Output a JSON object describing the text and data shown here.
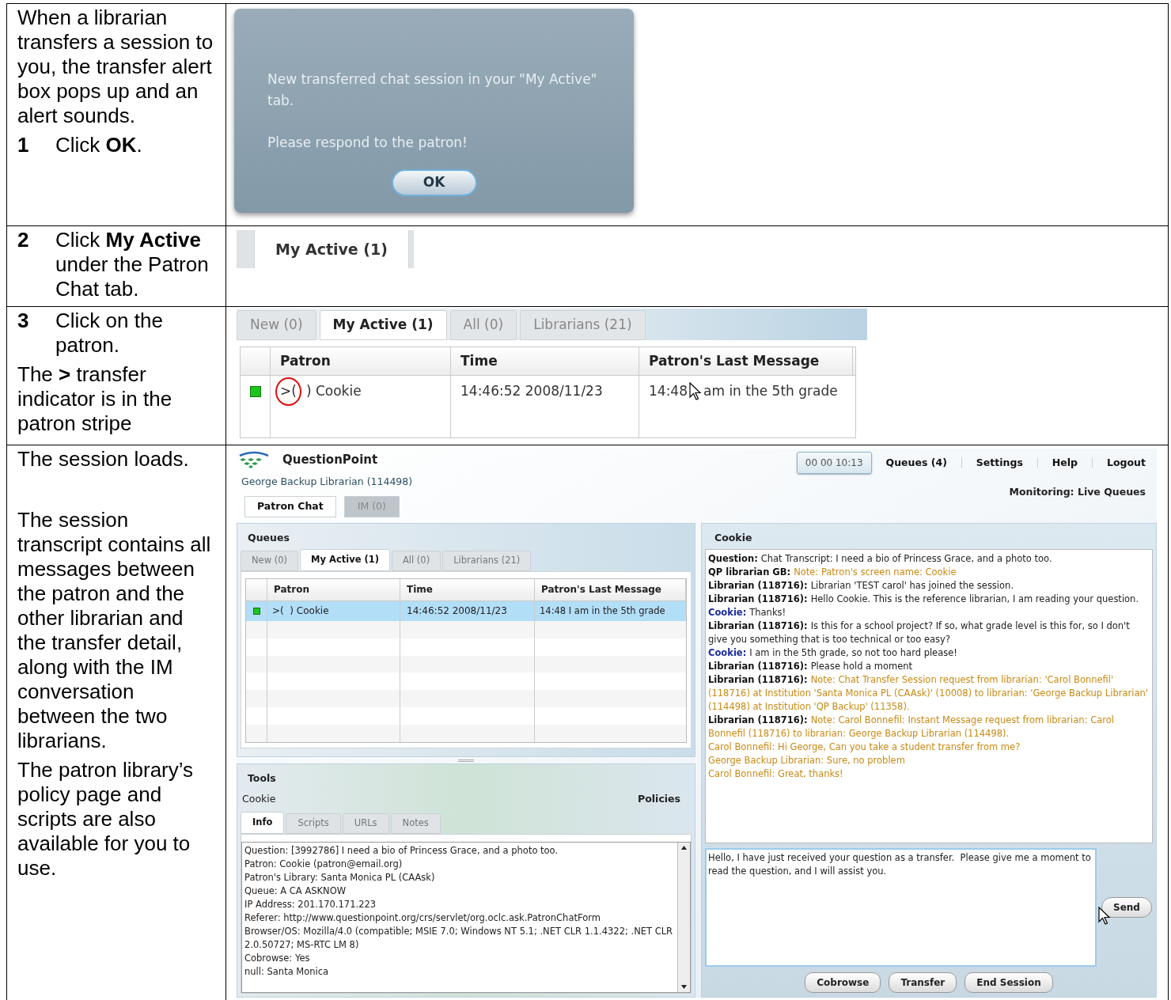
{
  "rows": [
    {
      "kind": "alert",
      "instructions": [
        {
          "text": "When a librarian transfers a session to you, the transfer alert box pops up and an alert sounds."
        },
        {
          "number": "1",
          "text": "Click **OK**."
        }
      ],
      "alert": {
        "message": "New transferred chat session in your \"My Active\" tab.",
        "prompt": "Please respond to the patron!",
        "button": "OK"
      }
    },
    {
      "kind": "tab",
      "instructions": [
        {
          "number": "2",
          "text": "Click **My Active** under the Patron Chat tab."
        }
      ],
      "tab": {
        "label": "My Active (1)",
        "selected": true
      }
    },
    {
      "kind": "queue",
      "instructions": [
        {
          "number": "3",
          "text": "Click on the patron."
        },
        {
          "text": "The **>** transfer indicator is in the patron stripe"
        }
      ],
      "queue": {
        "tabs": [
          {
            "label": "New (0)",
            "selected": false
          },
          {
            "label": "My Active (1)",
            "selected": true
          },
          {
            "label": "All (0)",
            "selected": false
          },
          {
            "label": "Librarians (21)",
            "selected": false
          }
        ],
        "columns": [
          "Patron",
          "Time",
          "Patron's Last Message"
        ],
        "row": {
          "indicator": ">(",
          "patron": ") Cookie",
          "time": "14:46:52 2008/11/23",
          "message_start": "14:48",
          "message_end": "am in the 5th grade"
        }
      }
    },
    {
      "kind": "session",
      "instructions": [
        {
          "text": "The session loads."
        },
        {
          "text": "The session transcript contains all messages between the patron and the other librarian and the transfer detail, along with the IM conversation between the two librarians."
        },
        {
          "text": "The patron library’s policy page and scripts are also available for you to use."
        }
      ],
      "app": {
        "brand": "QuestionPoint",
        "user": "George Backup Librarian (114498)",
        "timer": "00 00 10:13",
        "nav": [
          "Queues (4)",
          "Settings",
          "Help",
          "Logout"
        ],
        "monitoring": "Monitoring: Live Queues",
        "main_tabs": [
          {
            "label": "Patron Chat",
            "selected": true
          },
          {
            "label": "IM (0)",
            "selected": false
          }
        ],
        "queues": {
          "title": "Queues",
          "tabs": [
            {
              "label": "New (0)",
              "selected": false
            },
            {
              "label": "My Active (1)",
              "selected": true
            },
            {
              "label": "All (0)",
              "selected": false
            },
            {
              "label": "Librarians (21)",
              "selected": false
            }
          ],
          "columns": [
            "Patron",
            "Time",
            "Patron's Last Message"
          ],
          "rows": [
            {
              "patron": ">(  ) Cookie",
              "time": "14:46:52 2008/11/23",
              "message": "14:48 I am in the 5th grade",
              "selected": true
            }
          ]
        },
        "tools": {
          "title": "Tools",
          "patron": "Cookie",
          "policies": "Policies",
          "tabs": [
            {
              "label": "Info",
              "selected": true
            },
            {
              "label": "Scripts",
              "selected": false
            },
            {
              "label": "URLs",
              "selected": false
            },
            {
              "label": "Notes",
              "selected": false
            }
          ],
          "info": [
            "Question: [3992786] I need a bio of Princess Grace, and a photo too.",
            "Patron: Cookie (patron@email.org)",
            "Patron's Library: Santa Monica PL (CAAsk)",
            "Queue: A CA ASKNOW",
            "IP Address: 201.170.171.223",
            "Referer: http://www.questionpoint.org/crs/servlet/org.oclc.ask.PatronChatForm",
            "Browser/OS: Mozilla/4.0 (compatible; MSIE 7.0; Windows NT 5.1; .NET CLR 1.1.4322; .NET CLR 2.0.50727; MS-RTC LM 8)",
            "Cobrowse: Yes",
            "null: Santa Monica"
          ]
        },
        "chat": {
          "title": "Cookie",
          "transcript": [
            {
              "speaker": "Question:",
              "kind": "staff_message",
              "text": "Chat Transcript: I need a bio of Princess Grace, and a photo too."
            },
            {
              "speaker": "QP librarian GB:",
              "kind": "staff_note",
              "text": "Note: Patron's screen name: Cookie"
            },
            {
              "speaker": "Librarian (118716):",
              "kind": "staff_message",
              "text": "Librarian 'TEST carol' has joined the session."
            },
            {
              "speaker": "Librarian (118716):",
              "kind": "staff_message",
              "text": "Hello Cookie. This is the reference librarian, I am reading your question."
            },
            {
              "speaker": "Cookie:",
              "kind": "patron_message",
              "text": "Thanks!"
            },
            {
              "speaker": "Librarian (118716):",
              "kind": "staff_message",
              "text": "Is this for a school project? If so, what grade level is this for, so I don't give you something that is too technical or too easy?"
            },
            {
              "speaker": "Cookie:",
              "kind": "patron_message",
              "text": "I am in the 5th grade, so not too hard please!"
            },
            {
              "speaker": "Librarian (118716):",
              "kind": "staff_message",
              "text": "Please hold a moment"
            },
            {
              "speaker": "Librarian (118716):",
              "kind": "staff_note",
              "text": "Note: Chat Transfer Session request from librarian: 'Carol Bonnefil' (118716) at Institution 'Santa Monica PL (CAAsk)' (10008) to librarian: 'George Backup Librarian' (114498) at Institution 'QP Backup' (11358)."
            },
            {
              "speaker": "Librarian (118716):",
              "kind": "staff_note",
              "text": "Note: Carol Bonnefil: Instant Message request from librarian: Carol Bonnefil (118716) to librarian: George Backup Librarian (114498)."
            },
            {
              "kind": "note",
              "text": "Carol Bonnefil: Hi George, Can you take a student transfer from me?"
            },
            {
              "kind": "note",
              "text": "George Backup Librarian: Sure, no problem"
            },
            {
              "kind": "note",
              "text": "Carol Bonnefil: Great, thanks!"
            }
          ],
          "compose": "Hello, I have just received your question as a transfer.  Please give me a moment to read the question, and I will assist you.",
          "send": "Send",
          "buttons": [
            "Cobrowse",
            "Transfer",
            "End Session"
          ]
        }
      }
    }
  ]
}
